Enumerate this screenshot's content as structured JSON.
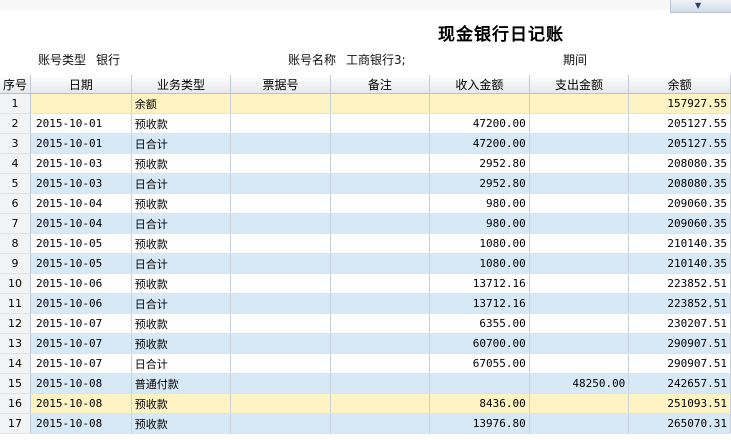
{
  "report": {
    "title": "现金银行日记账",
    "account_type_label": "账号类型",
    "account_type_value": "银行",
    "account_name_label": "账号名称",
    "account_name_value": "工商银行3;",
    "period_label": "期间"
  },
  "table": {
    "headers": [
      "序号",
      "日期",
      "业务类型",
      "票据号",
      "备注",
      "收入金额",
      "支出金额",
      "余额"
    ],
    "rows": [
      [
        "1",
        "",
        "余额",
        "",
        "",
        "",
        "",
        "157927.55"
      ],
      [
        "2",
        "2015-10-01",
        "预收款",
        "",
        "",
        "47200.00",
        "",
        "205127.55"
      ],
      [
        "3",
        "2015-10-01",
        "日合计",
        "",
        "",
        "47200.00",
        "",
        "205127.55"
      ],
      [
        "4",
        "2015-10-03",
        "预收款",
        "",
        "",
        "2952.80",
        "",
        "208080.35"
      ],
      [
        "5",
        "2015-10-03",
        "日合计",
        "",
        "",
        "2952.80",
        "",
        "208080.35"
      ],
      [
        "6",
        "2015-10-04",
        "预收款",
        "",
        "",
        "980.00",
        "",
        "209060.35"
      ],
      [
        "7",
        "2015-10-04",
        "日合计",
        "",
        "",
        "980.00",
        "",
        "209060.35"
      ],
      [
        "8",
        "2015-10-05",
        "预收款",
        "",
        "",
        "1080.00",
        "",
        "210140.35"
      ],
      [
        "9",
        "2015-10-05",
        "日合计",
        "",
        "",
        "1080.00",
        "",
        "210140.35"
      ],
      [
        "10",
        "2015-10-06",
        "预收款",
        "",
        "",
        "13712.16",
        "",
        "223852.51"
      ],
      [
        "11",
        "2015-10-06",
        "日合计",
        "",
        "",
        "13712.16",
        "",
        "223852.51"
      ],
      [
        "12",
        "2015-10-07",
        "预收款",
        "",
        "",
        "6355.00",
        "",
        "230207.51"
      ],
      [
        "13",
        "2015-10-07",
        "预收款",
        "",
        "",
        "60700.00",
        "",
        "290907.51"
      ],
      [
        "14",
        "2015-10-07",
        "日合计",
        "",
        "",
        "67055.00",
        "",
        "290907.51"
      ],
      [
        "15",
        "2015-10-08",
        "普通付款",
        "",
        "",
        "",
        "48250.00",
        "242657.51"
      ],
      [
        "16",
        "2015-10-08",
        "预收款",
        "",
        "",
        "8436.00",
        "",
        "251093.51"
      ],
      [
        "17",
        "2015-10-08",
        "预收款",
        "",
        "",
        "13976.80",
        "",
        "265070.31"
      ]
    ]
  }
}
